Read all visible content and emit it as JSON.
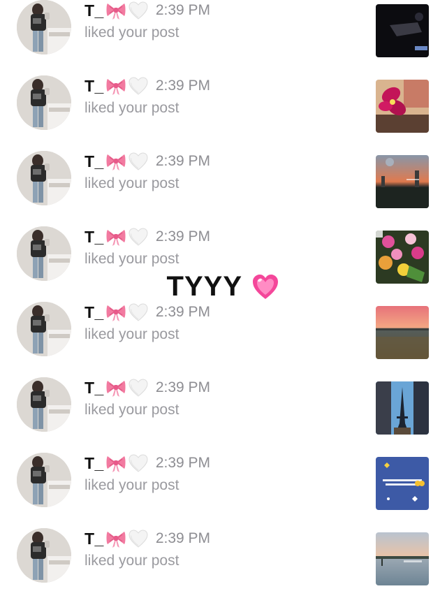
{
  "notifications": [
    {
      "username": "T_",
      "time": "2:39 PM",
      "action": "liked your post",
      "thumbnail": "dark-night-photo"
    },
    {
      "username": "T_",
      "time": "2:39 PM",
      "action": "liked your post",
      "thumbnail": "pink-flower-photo"
    },
    {
      "username": "T_",
      "time": "2:39 PM",
      "action": "liked your post",
      "thumbnail": "sunset-city-photo"
    },
    {
      "username": "T_",
      "time": "2:39 PM",
      "action": "liked your post",
      "thumbnail": "flower-bouquet-photo"
    },
    {
      "username": "T_",
      "time": "2:39 PM",
      "action": "liked your post",
      "thumbnail": "sunset-field-photo"
    },
    {
      "username": "T_",
      "time": "2:39 PM",
      "action": "liked your post",
      "thumbnail": "eiffel-tower-photo"
    },
    {
      "username": "T_",
      "time": "2:39 PM",
      "action": "liked your post",
      "thumbnail": "text-post-image"
    },
    {
      "username": "T_",
      "time": "2:39 PM",
      "action": "liked your post",
      "thumbnail": "beach-sunset-photo"
    }
  ],
  "overlay": {
    "text": "TYYY",
    "emoji_icon": "pink-sparkling-heart-icon"
  },
  "icons": {
    "bow": "pink-bow-icon",
    "heart": "white-heart-icon"
  },
  "colors": {
    "username": "#111111",
    "secondary_text": "#8e8e93",
    "bow": "#f27aa0",
    "overlay_heart": "#f4479a"
  }
}
